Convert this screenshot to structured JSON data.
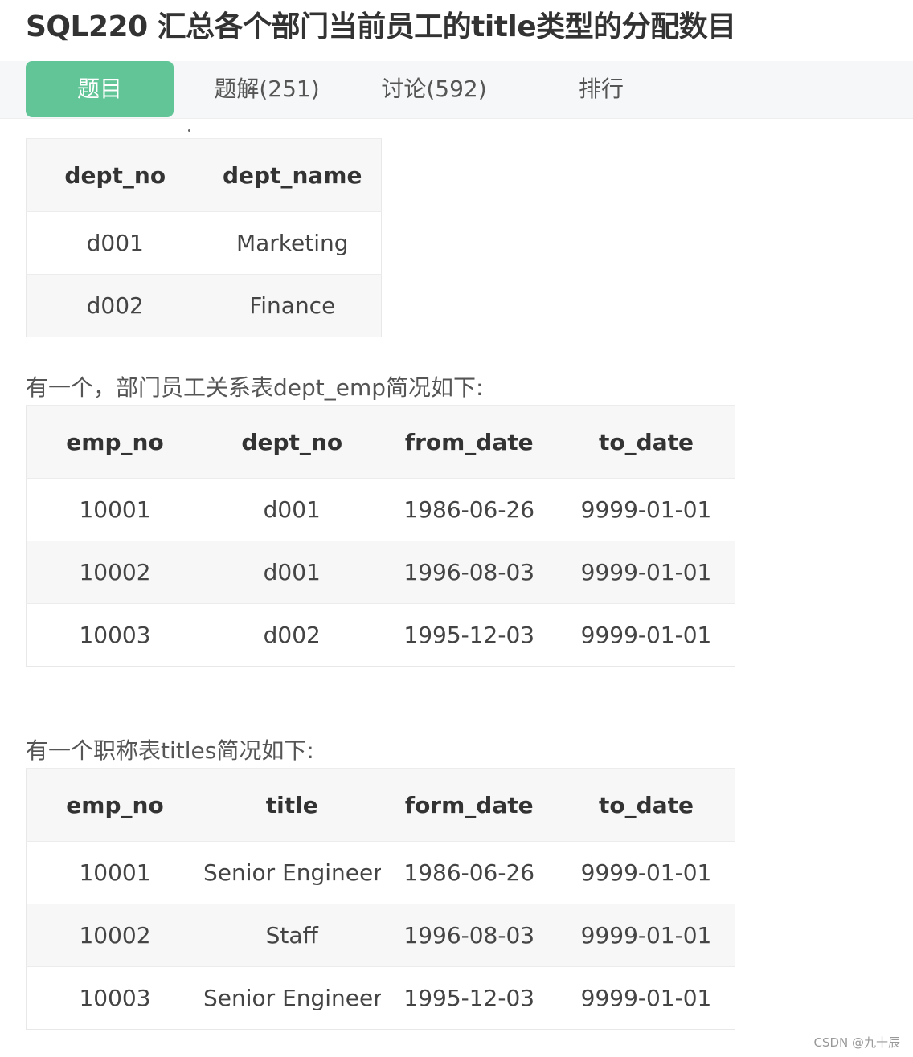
{
  "page": {
    "title": "SQL220  汇总各个部门当前员工的title类型的分配数目"
  },
  "tabs": [
    {
      "label": "题目",
      "active": true
    },
    {
      "label": "题解(251)",
      "active": false
    },
    {
      "label": "讨论(592)",
      "active": false
    },
    {
      "label": "排行",
      "active": false
    }
  ],
  "departments_table": {
    "headers": [
      "dept_no",
      "dept_name"
    ],
    "rows": [
      [
        "d001",
        "Marketing"
      ],
      [
        "d002",
        "Finance"
      ]
    ]
  },
  "dept_emp_intro": "有一个，部门员工关系表dept_emp简况如下:",
  "dept_emp_table": {
    "headers": [
      "emp_no",
      "dept_no",
      "from_date",
      "to_date"
    ],
    "rows": [
      [
        "10001",
        "d001",
        "1986-06-26",
        "9999-01-01"
      ],
      [
        "10002",
        "d001",
        "1996-08-03",
        "9999-01-01"
      ],
      [
        "10003",
        "d002",
        "1995-12-03",
        "9999-01-01"
      ]
    ]
  },
  "titles_intro": "有一个职称表titles简况如下:",
  "titles_table": {
    "headers": [
      "emp_no",
      "title",
      "form_date",
      "to_date"
    ],
    "rows": [
      [
        "10001",
        "Senior Engineer",
        "1986-06-26",
        "9999-01-01"
      ],
      [
        "10002",
        "Staff",
        "1996-08-03",
        "9999-01-01"
      ],
      [
        "10003",
        "Senior Engineer",
        "1995-12-03",
        "9999-01-01"
      ]
    ]
  },
  "watermark": "CSDN @九十辰",
  "colors": {
    "active_tab": "#62c598",
    "tabbar_bg": "#f6f7f8",
    "header_bg": "#f7f7f7"
  }
}
